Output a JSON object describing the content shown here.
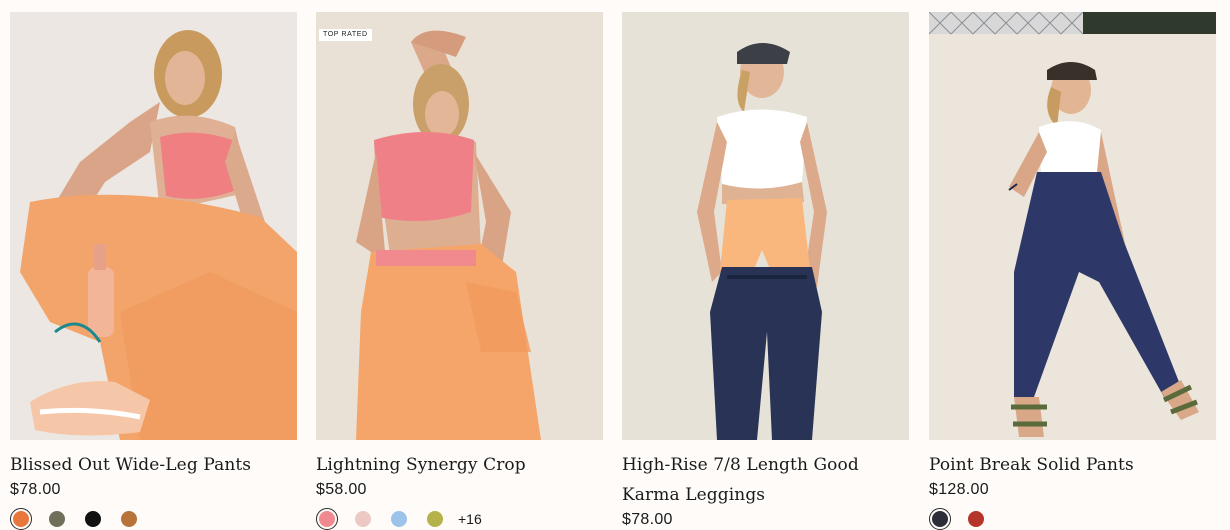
{
  "products": [
    {
      "title": "Blissed Out Wide-Leg Pants",
      "price": "$78.00",
      "badge": "",
      "swatches": [
        "#e8773d",
        "#6f6f5a",
        "#111111",
        "#b8733a"
      ],
      "more": "",
      "photo": "photo of model in pink sports bra and orange wide-leg pants sitting"
    },
    {
      "title": "Lightning Synergy Crop",
      "price": "$58.00",
      "badge": "TOP RATED",
      "swatches": [
        "#f08a90",
        "#ecc9c4",
        "#9cc3ea",
        "#b5b24a"
      ],
      "more": "+16",
      "photo": "photo of model in pink crop top and orange pants"
    },
    {
      "title": "High-Rise 7/8 Length Good Karma Leggings",
      "price": "$78.00",
      "badge": "",
      "swatches": [],
      "more": "",
      "photo": "photo of model in white top, peach shorts and navy pants"
    },
    {
      "title": "Point Break Solid Pants",
      "price": "$128.00",
      "badge": "",
      "swatches": [
        "#2d2d3a",
        "#b5352a"
      ],
      "more": "",
      "photo": "photo of model in white top and navy drawstring pants"
    }
  ]
}
